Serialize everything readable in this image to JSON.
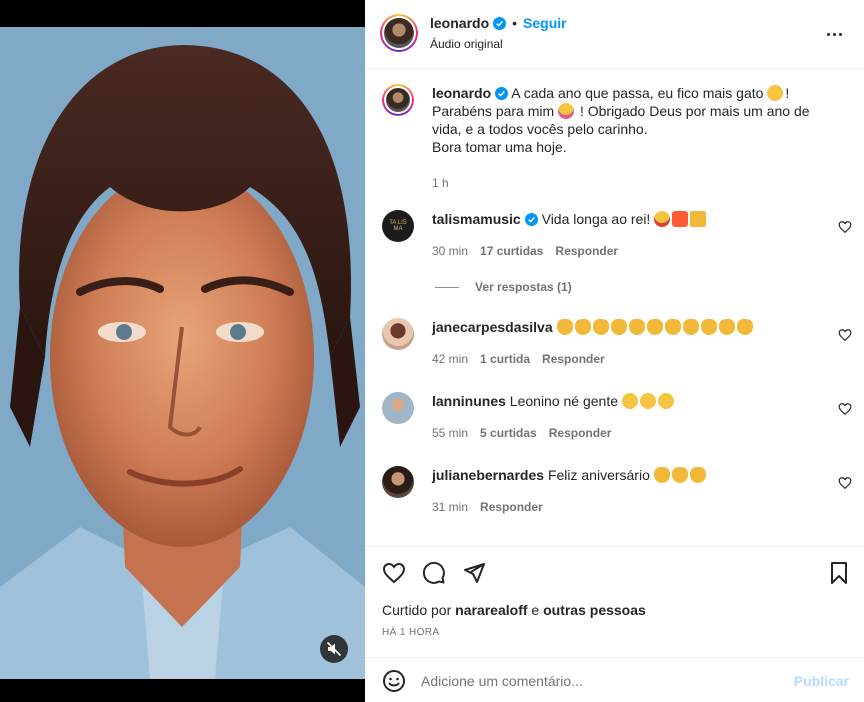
{
  "post": {
    "author": "leonardo",
    "follow_label": "Seguir",
    "separator": "•",
    "audio": "Áudio original",
    "caption": {
      "author": "leonardo",
      "line1": "A cada ano que passa, eu fico mais gato",
      "line1_end": "!",
      "line2a": "Parabéns para mim",
      "line2b": "! Obrigado Deus por mais um ano de",
      "line3": "vida, e a todos vocês pelo carinho.",
      "line4": "Bora tomar uma hoje.",
      "time": "1 h"
    }
  },
  "comments": [
    {
      "user": "talismamusic",
      "verified": true,
      "text": "Vida longa ao rei!",
      "emojis": [
        "star-struck",
        "collision",
        "party-popper"
      ],
      "time": "30 min",
      "likes": "17 curtidas",
      "reply": "Responder",
      "view_replies": "Ver respostas (1)",
      "avatar_text": "TA LIS MA"
    },
    {
      "user": "janecarpesdasilva",
      "verified": false,
      "text": "",
      "emojis": [
        "clap",
        "clap",
        "clap",
        "clap",
        "clap",
        "clap",
        "clap",
        "clap",
        "clap",
        "clap",
        "clap"
      ],
      "time": "42 min",
      "likes": "1 curtida",
      "reply": "Responder"
    },
    {
      "user": "lanninunes",
      "verified": false,
      "text": "Leonino né gente",
      "emojis": [
        "laugh",
        "laugh",
        "laugh"
      ],
      "time": "55 min",
      "likes": "5 curtidas",
      "reply": "Responder"
    },
    {
      "user": "julianebernardes",
      "verified": false,
      "text": "Feliz aniversário",
      "emojis": [
        "clap",
        "clap",
        "clap"
      ],
      "time": "31 min",
      "likes": "",
      "reply": "Responder"
    }
  ],
  "actions": {
    "liked_prefix": "Curtido por",
    "liked_user": "nararealoff",
    "liked_suffix": "e",
    "liked_others": "outras pessoas",
    "when": "HÁ 1 HORA"
  },
  "composer": {
    "placeholder": "Adicione um comentário...",
    "publish_label": "Publicar"
  },
  "colors": {
    "accent": "#0095f6",
    "publish_disabled": "#b3dbff",
    "muted_text": "#737373",
    "verified": "#0095f6"
  }
}
